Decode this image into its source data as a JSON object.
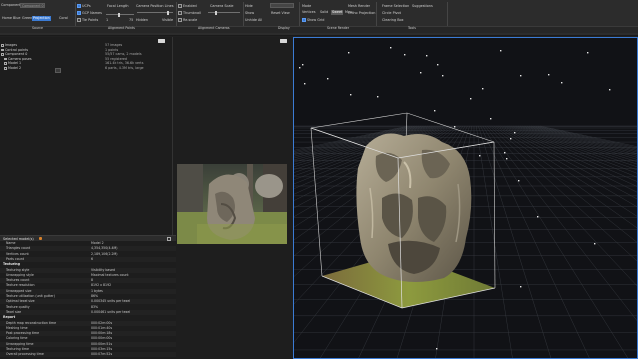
{
  "app": {
    "accent": "#3b7bd4",
    "background": "#111216"
  },
  "ribbon": {
    "groups": {
      "source": "Source",
      "alignment_points": "Alignment Points",
      "alignment_cameras": "Alignment Cameras",
      "display": "Display",
      "scene_render": "Scene Render",
      "tools": "Tools"
    },
    "source": {
      "component_label": "Component",
      "component_value": "Component 0",
      "buttons": [
        "Home",
        "Blue",
        "Green",
        "Projection",
        "Coral"
      ]
    },
    "points": {
      "checkboxes": [
        "UCPs",
        "GCP Names",
        "Tie Points"
      ],
      "focal_label": "Focal Length",
      "slider_min": "1",
      "slider_max": "75",
      "camera_lines_label": "Camera Position Lines",
      "hidden_label": "Hidden",
      "visible_label": "Visible"
    },
    "cameras": {
      "checkboxes": [
        "Enabled",
        "Thumbnail",
        "Re-scale"
      ],
      "camera_scale_label": "Camera Scale",
      "slider_min": "1",
      "slider_max": "?"
    },
    "display": {
      "items": [
        "Hide",
        "Show",
        "Unhide All"
      ],
      "dropdown": "",
      "reset_view": "Reset View"
    },
    "scene": {
      "mode_label": "Mode",
      "modes": [
        "Vertices",
        "Solid",
        "Sweet",
        "Max"
      ],
      "show_grid": "Show Grid"
    },
    "tools": {
      "mesh_render": "Mesh Render",
      "ortho_projection": "Ortho Projection",
      "frame_selection": "Frame Selection",
      "suggestions": "Suggestions",
      "circle_pivot": "Circle Pivot",
      "clearing_box": "Clearing Box"
    }
  },
  "tree": {
    "items": [
      "Images",
      "Control points",
      "Component 0",
      "Camera poses",
      "Model 1",
      "Model 2"
    ],
    "values": [
      "57 images",
      "1 points",
      "55/57 cams, 2 models",
      "55 registered",
      "161.4k tris, 36.6k verts",
      "6 parts, 4.3M tris, large"
    ]
  },
  "properties": {
    "title": "Selected model(s)",
    "rows": [
      {
        "k": "Name",
        "v": "Model 2",
        "sec": false
      },
      {
        "k": "Triangles count",
        "v": "4,354,350(4.4M)",
        "sec": false
      },
      {
        "k": "Vertices count",
        "v": "2,189,106(2.2M)",
        "sec": false
      },
      {
        "k": "Parts count",
        "v": "6",
        "sec": false
      },
      {
        "k": "Texturing",
        "v": "",
        "sec": true
      },
      {
        "k": "Texturing style",
        "v": "Visibility based",
        "sec": false
      },
      {
        "k": "Unwrapping style",
        "v": "Maximal textures count",
        "sec": false
      },
      {
        "k": "Textures count",
        "v": "8",
        "sec": false
      },
      {
        "k": "Texture resolution",
        "v": "8192 x 8192",
        "sec": false
      },
      {
        "k": "Unwrapped size",
        "v": "1 bytes",
        "sec": false
      },
      {
        "k": "Texture utilization (unit gutter)",
        "v": "86%",
        "sec": false
      },
      {
        "k": "Optimal texel size",
        "v": "0.000345 units per texel",
        "sec": false
      },
      {
        "k": "Texture quality",
        "v": "83%",
        "sec": false
      },
      {
        "k": "Texel size",
        "v": "0.000461 units per texel",
        "sec": false
      },
      {
        "k": "Report",
        "v": "",
        "sec": true
      },
      {
        "k": "Depth map reconstruction time",
        "v": "000:02m:00s",
        "sec": false
      },
      {
        "k": "Meshing time",
        "v": "000:01m:40s",
        "sec": false
      },
      {
        "k": "Post processing time",
        "v": "000:00m:18s",
        "sec": false
      },
      {
        "k": "Coloring time",
        "v": "000:00m:00s",
        "sec": false
      },
      {
        "k": "Unwrapping time",
        "v": "000:00m:51s",
        "sec": false
      },
      {
        "k": "Texturing time",
        "v": "000:03m:15s",
        "sec": false
      },
      {
        "k": "Overall processing time",
        "v": "000:07m:52s",
        "sec": false
      }
    ]
  }
}
